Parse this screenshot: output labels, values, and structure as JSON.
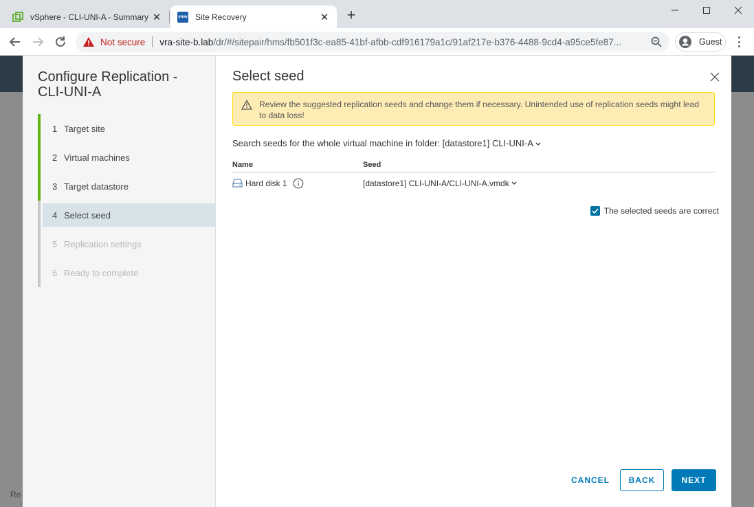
{
  "browser": {
    "tabs": [
      {
        "title": "vSphere - CLI-UNI-A - Summary"
      },
      {
        "title": "Site Recovery",
        "favicon_text": "vmw"
      }
    ],
    "security_label": "Not secure",
    "url_host": "vra-site-b.lab",
    "url_path": "/dr/#/sitepair/hms/fb501f3c-ea85-41bf-afbb-cdf916179a1c/91af217e-b376-4488-9cd4-a95ce5fe87...",
    "profile_label": "Guest"
  },
  "background": {
    "partial_text": "Re"
  },
  "wizard": {
    "title": "Configure Replication - CLI-UNI-A",
    "steps": [
      {
        "num": "1",
        "label": "Target site"
      },
      {
        "num": "2",
        "label": "Virtual machines"
      },
      {
        "num": "3",
        "label": "Target datastore"
      },
      {
        "num": "4",
        "label": "Select seed"
      },
      {
        "num": "5",
        "label": "Replication settings"
      },
      {
        "num": "6",
        "label": "Ready to complete"
      }
    ]
  },
  "page": {
    "title": "Select seed",
    "alert": "Review the suggested replication seeds and change them if necessary. Unintended use of replication seeds might lead to data loss!",
    "search_prefix": "Search seeds for the whole virtual machine in folder:",
    "search_folder": "[datastore1] CLI-UNI-A",
    "table": {
      "headers": {
        "name": "Name",
        "seed": "Seed"
      },
      "rows": [
        {
          "name": "Hard disk 1",
          "seed": "[datastore1] CLI-UNI-A/CLI-UNI-A.vmdk"
        }
      ]
    },
    "checkbox_label": "The selected seeds are correct",
    "checkbox_checked": true
  },
  "buttons": {
    "cancel": "CANCEL",
    "back": "BACK",
    "next": "NEXT"
  },
  "colors": {
    "accent": "#0079b8",
    "step_done": "#60b515",
    "alert_bg": "#feecb5",
    "not_secure": "#c5221f"
  }
}
